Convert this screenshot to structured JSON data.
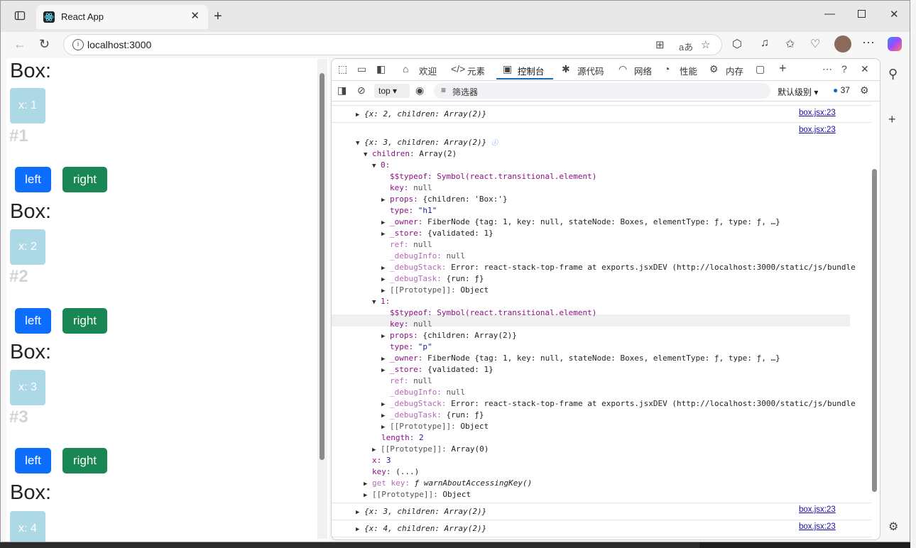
{
  "browser": {
    "tab_title": "React App",
    "url": "localhost:3000"
  },
  "page": {
    "boxes": [
      {
        "heading": "Box:",
        "x_label": "x: 1",
        "number": "#1",
        "left": "left",
        "right": "right"
      },
      {
        "heading": "Box:",
        "x_label": "x: 2",
        "number": "#2",
        "left": "left",
        "right": "right"
      },
      {
        "heading": "Box:",
        "x_label": "x: 3",
        "number": "#3",
        "left": "left",
        "right": "right"
      },
      {
        "heading": "Box:",
        "x_label": "x: 4"
      }
    ]
  },
  "devtools": {
    "tabs": [
      "欢迎",
      "元素",
      "控制台",
      "源代码",
      "网络",
      "性能",
      "内存"
    ],
    "context": "top",
    "filter_placeholder": "筛选器",
    "level": "默认级别",
    "message_count": "37",
    "source": "box.jsx:23",
    "lines": {
      "l0": "{x: 2, children: Array(2)}",
      "l1": "{x: 3, children: Array(2)}",
      "children": "children:",
      "children_v": "Array(2)",
      "i0": "0:",
      "typeof_k": "$$typeof:",
      "typeof_v": "Symbol(react.transitional.element)",
      "key_k": "key:",
      "null": "null",
      "props_k": "props:",
      "props0_v": "{children: 'Box:'}",
      "type_k": "type:",
      "type0_v": "\"h1\"",
      "owner_k": "_owner:",
      "owner_v": "FiberNode {tag: 1, key: null, stateNode: Boxes, elementType: ƒ, type: ƒ, …}",
      "store_k": "_store:",
      "store_v": "{validated: 1}",
      "ref_k": "ref:",
      "debuginfo_k": "_debugInfo:",
      "debugstack_k": "_debugStack:",
      "debugstack_v": "Error: react-stack-top-frame at exports.jsxDEV (http://localhost:3000/static/js/bundle",
      "debugtask_k": "_debugTask:",
      "debugtask_v": "{run: ƒ}",
      "proto_k": "[[Prototype]]:",
      "proto_obj": "Object",
      "i1": "1:",
      "props1_v": "{children: Array(2)}",
      "type1_v": "\"p\"",
      "length_k": "length:",
      "length_v": "2",
      "proto_arr": "Array(0)",
      "x_k": "x:",
      "x_v": "3",
      "key_lazy": "(...)",
      "getkey_k": "get key:",
      "getkey_v": "ƒ warnAboutAccessingKey()",
      "l_after1": "{x: 3, children: Array(2)}",
      "l_after2": "{x: 4, children: Array(2)}"
    }
  }
}
